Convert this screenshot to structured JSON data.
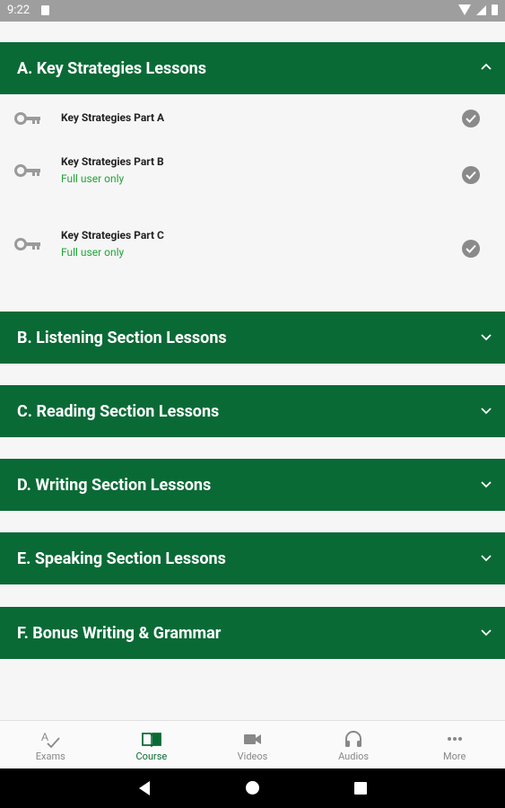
{
  "status_bar": {
    "time": "9:22"
  },
  "sections": [
    {
      "label": "A. Key Strategies Lessons",
      "expanded": true,
      "lessons": [
        {
          "title": "Key Strategies Part A",
          "note": ""
        },
        {
          "title": "Key Strategies Part B",
          "note": "Full user only"
        },
        {
          "title": "Key Strategies Part C",
          "note": "Full user only"
        }
      ]
    },
    {
      "label": "B. Listening Section Lessons",
      "expanded": false
    },
    {
      "label": "C. Reading Section Lessons",
      "expanded": false
    },
    {
      "label": "D. Writing Section Lessons",
      "expanded": false
    },
    {
      "label": "E. Speaking Section Lessons",
      "expanded": false
    },
    {
      "label": "F. Bonus Writing & Grammar",
      "expanded": false
    }
  ],
  "bottom_nav": [
    {
      "label": "Exams",
      "icon": "spellcheck-icon",
      "active": false
    },
    {
      "label": "Course",
      "icon": "book-icon",
      "active": true
    },
    {
      "label": "Videos",
      "icon": "videocam-icon",
      "active": false
    },
    {
      "label": "Audios",
      "icon": "headphones-icon",
      "active": false
    },
    {
      "label": "More",
      "icon": "more-dots-icon",
      "active": false
    }
  ],
  "colors": {
    "header_green": "#0a6a36",
    "note_green": "#1fa637",
    "background": "#f6f6f6"
  }
}
